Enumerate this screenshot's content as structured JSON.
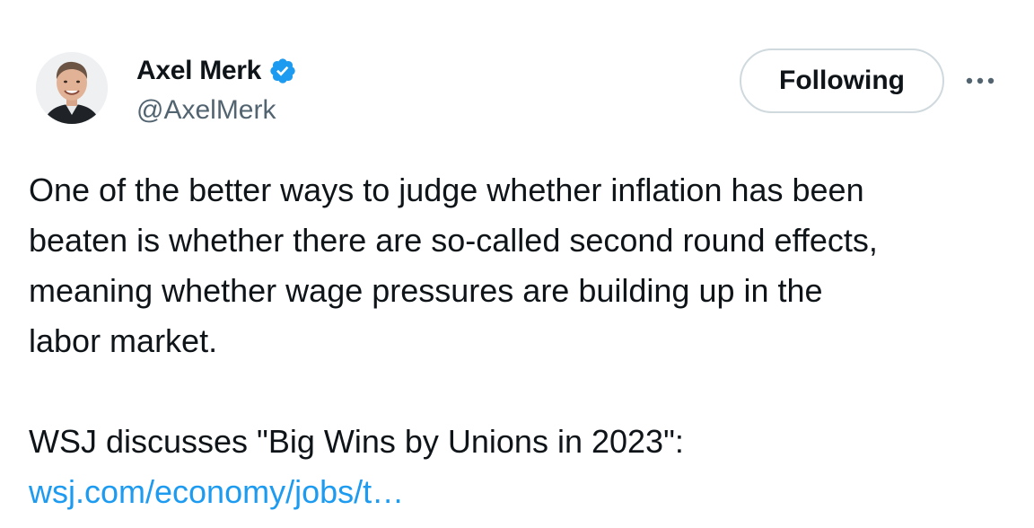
{
  "author": {
    "display_name": "Axel Merk",
    "handle": "@AxelMerk",
    "verified": true,
    "verified_color": "#1d9bf0",
    "avatar_icon": "avatar-photo"
  },
  "actions": {
    "follow_label": "Following",
    "more_icon": "more-horizontal-icon"
  },
  "body": {
    "lines": [
      "One of the better ways to judge whether inflation has been",
      "beaten is whether there are so-called second round effects,",
      "meaning whether wage pressures are building up in the",
      "labor market."
    ],
    "quote_line": "WSJ discusses \"Big Wins by Unions in 2023\":",
    "link_text": "wsj.com/economy/jobs/t…",
    "link_color": "#1d9bf0"
  }
}
